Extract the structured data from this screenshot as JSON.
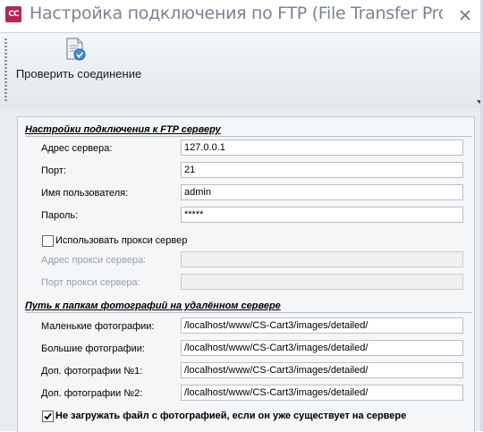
{
  "window": {
    "app_icon_text": "CC",
    "title": "Настройка подключения по FTP (File Transfer Proto..."
  },
  "toolbar": {
    "test_connection_label": "Проверить соединение"
  },
  "ftp_section": {
    "title": "Настройки подключения к FTP серверу",
    "server_address_label": "Адрес сервера:",
    "server_address_value": "127.0.0.1",
    "port_label": "Порт:",
    "port_value": "21",
    "username_label": "Имя пользователя:",
    "username_value": "admin",
    "password_label": "Пароль:",
    "password_value": "*****",
    "use_proxy_label": "Использовать прокси сервер",
    "use_proxy_checked": false,
    "proxy_address_label": "Адрес прокси сервера:",
    "proxy_address_value": "",
    "proxy_port_label": "Порт прокси сервера:",
    "proxy_port_value": ""
  },
  "paths_section": {
    "title": "Путь к папкам фотографий на удалённом сервере",
    "small_photos_label": "Маленькие фотографии:",
    "small_photos_value": "/localhost/www/CS-Cart3/images/detailed/",
    "large_photos_label": "Большие фотографии:",
    "large_photos_value": "/localhost/www/CS-Cart3/images/detailed/",
    "extra1_label": "Доп. фотографии №1:",
    "extra1_value": "/localhost/www/CS-Cart3/images/detailed/",
    "extra2_label": "Доп. фотографии №2:",
    "extra2_value": "/localhost/www/CS-Cart3/images/detailed/",
    "skip_existing_label": "Не загружать файл с фотографией, если он уже существует на сервере",
    "skip_existing_checked": true
  },
  "icons": {
    "app": "app-logo-icon",
    "close": "close-icon",
    "test_connection": "document-check-icon",
    "checkmark": "checkmark-icon"
  },
  "colors": {
    "app_icon": "#b3265a",
    "title_text": "#7a8491",
    "panel_bg": "#e9ecf0"
  }
}
